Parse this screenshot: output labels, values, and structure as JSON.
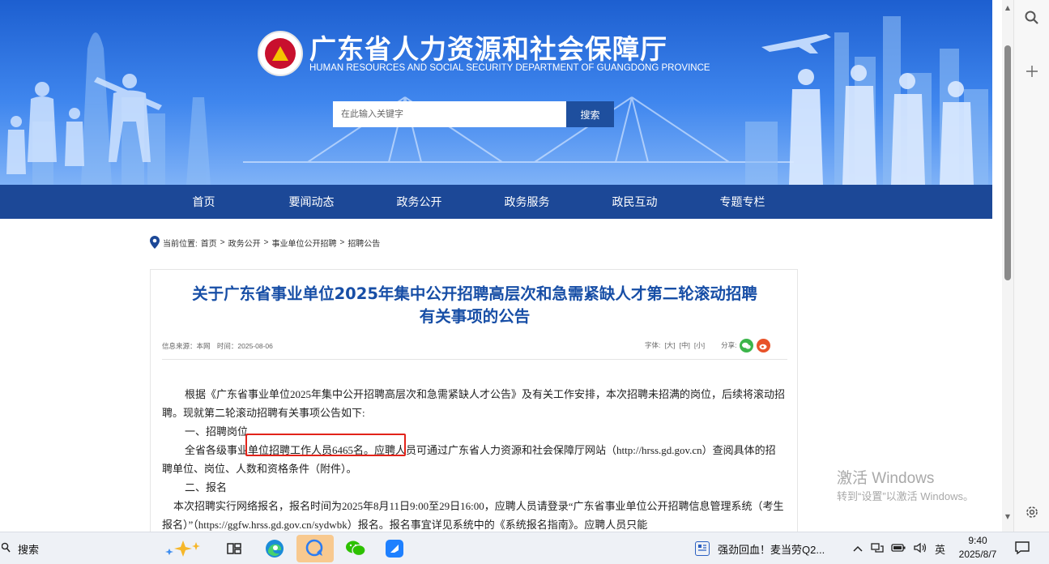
{
  "site": {
    "title": "广东省人力资源和社会保障厅",
    "subtitle": "HUMAN RESOURCES AND SOCIAL SECURITY DEPARTMENT OF GUANGDONG PROVINCE",
    "search_placeholder": "在此输入关键字",
    "search_button": "搜索"
  },
  "nav": {
    "items": [
      {
        "label": "首页"
      },
      {
        "label": "要闻动态"
      },
      {
        "label": "政务公开"
      },
      {
        "label": "政务服务"
      },
      {
        "label": "政民互动"
      },
      {
        "label": "专题专栏"
      }
    ]
  },
  "breadcrumb": {
    "prefix": "当前位置:",
    "items": [
      "首页",
      "政务公开",
      "事业单位公开招聘",
      "招聘公告"
    ],
    "separator": ">"
  },
  "article": {
    "title_line1": "关于广东省事业单位2025年集中公开招聘高层次和急需紧缺人才第二轮滚动招聘",
    "title_line2": "有关事项的公告",
    "source": "信息来源：本网",
    "date": "时间：2025-08-06",
    "font_size_label": "字体:",
    "font_sizes": [
      "[大]",
      "[中]",
      "[小]"
    ],
    "share_label": "分享:",
    "paragraphs": {
      "p1": "根据《广东省事业单位2025年集中公开招聘高层次和急需紧缺人才公告》及有关工作安排，本次招聘未招满的岗位，后续将滚动招聘。现就第二轮滚动招聘有关事项公告如下:",
      "h1": "一、招聘岗位",
      "p2": "全省各级事业单位招聘工作人员6465名。应聘人员可通过广东省人力资源和社会保障厅网站（http://hrss.gd.gov.cn）查阅具体的招聘单位、岗位、人数和资格条件（附件）。",
      "h2": "二、报名",
      "p3": "本次招聘实行网络报名，报名时间为2025年8月11日9:00至29日16:00，应聘人员请登录“广东省事业单位公开招聘信息管理系统（考生报名）”（https://ggfw.hrss.gd.gov.cn/sydwbk）报名。报名事宜详见系统中的《系统报名指南》。应聘人员只能"
    }
  },
  "watermark": {
    "line1": "激活 Windows",
    "line2": "转到“设置”以激活 Windows。"
  },
  "taskbar": {
    "search_label": "搜索",
    "news_text": "强劲回血！麦当劳Q2...",
    "ime": "英",
    "time": "9:40",
    "date": "2025/8/7"
  },
  "colors": {
    "nav_bg": "#1c4897",
    "title_blue": "#174ea6",
    "highlight_red": "#e2231a",
    "banner_top": "#1d5fd0"
  }
}
